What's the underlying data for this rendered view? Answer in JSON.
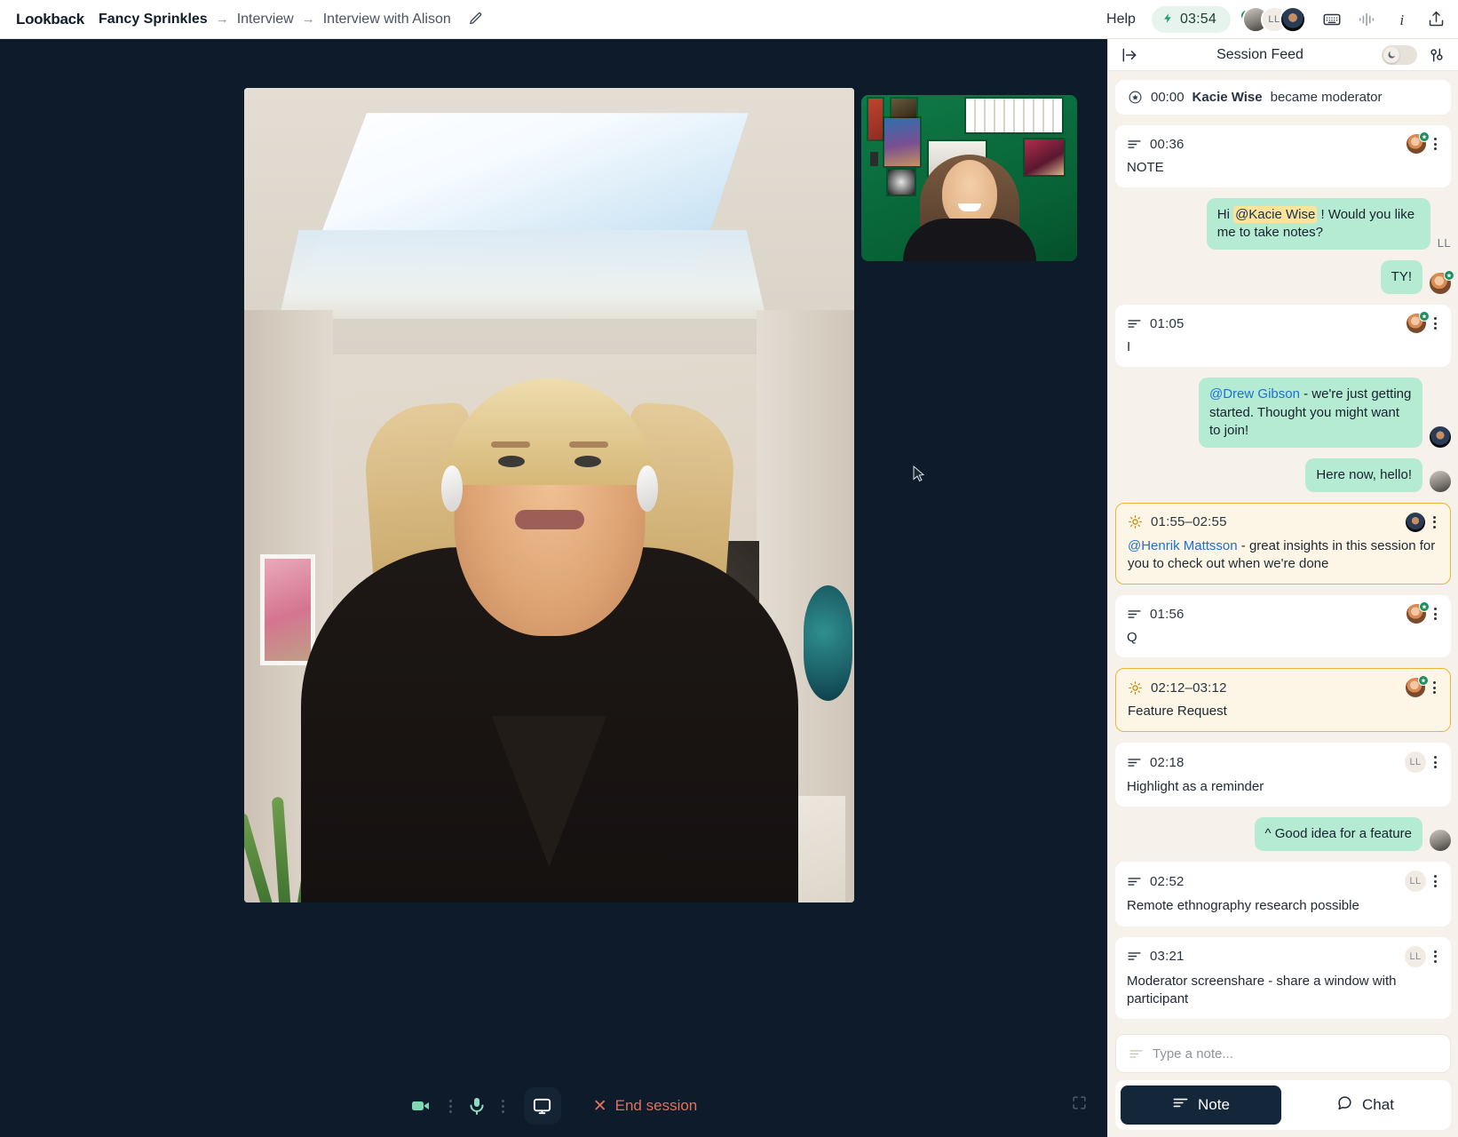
{
  "topbar": {
    "brand": "Lookback",
    "breadcrumb": [
      "Fancy Sprinkles",
      "Interview",
      "Interview with Alison"
    ],
    "separator": "→",
    "edit_icon": "pencil-icon",
    "help_label": "Help",
    "timer": "03:54",
    "timer_icon": "bolt-icon",
    "avatar_initials": "LL",
    "icons": [
      "keyboard-icon",
      "audio-waveform-icon",
      "info-icon",
      "share-icon"
    ]
  },
  "stage": {
    "controls": {
      "camera_icon": "video-camera-icon",
      "mic_icon": "microphone-icon",
      "screenshare_icon": "screen-share-icon",
      "end_session_label": "End session",
      "end_icon": "close-x-icon",
      "fullscreen_icon": "fullscreen-icon"
    }
  },
  "panel": {
    "collapse_icon": "panel-collapse-icon",
    "title": "Session Feed",
    "theme_toggle_icon": "moon-icon",
    "filter_icon": "filter-settings-icon",
    "system_event": {
      "icon": "moderator-badge-icon",
      "time": "00:00",
      "actor": "Kacie Wise",
      "text": "became moderator"
    },
    "feed": [
      {
        "kind": "note",
        "time": "00:36",
        "body": "NOTE",
        "avatar": "kacie",
        "star": true
      },
      {
        "kind": "chat",
        "align": "right",
        "mention": "@Kacie Wise",
        "prefix": "Hi ",
        "suffix": " ! Would you like me to take notes?",
        "avatar_initials": "LL"
      },
      {
        "kind": "chat",
        "align": "right",
        "text": "TY!",
        "avatar": "kacie",
        "star": true
      },
      {
        "kind": "note",
        "time": "01:05",
        "body": "I",
        "avatar": "kacie",
        "star": true
      },
      {
        "kind": "chat",
        "align": "right",
        "mention": "@Drew Gibson",
        "prefix": "",
        "suffix": " - we're just getting started. Thought you might want to join!",
        "avatar": "drew"
      },
      {
        "kind": "chat",
        "align": "right",
        "text": "Here now, hello!",
        "avatar": "henrik"
      },
      {
        "kind": "highlight",
        "time": "01:55–02:55",
        "mention": "@Henrik Mattsson",
        "suffix": " - great insights in this session for you to check out when we're done",
        "avatar": "drew"
      },
      {
        "kind": "note",
        "time": "01:56",
        "body": "Q",
        "avatar": "kacie",
        "star": true
      },
      {
        "kind": "highlight",
        "time": "02:12–03:12",
        "body": "Feature Request",
        "avatar": "kacie",
        "star": true
      },
      {
        "kind": "note",
        "time": "02:18",
        "body": "Highlight as a reminder",
        "avatar_initials": "LL"
      },
      {
        "kind": "chat",
        "align": "right",
        "text": "^ Good idea for a feature",
        "avatar": "henrik"
      },
      {
        "kind": "note",
        "time": "02:52",
        "body": "Remote ethnography research possible",
        "avatar_initials": "LL"
      },
      {
        "kind": "note",
        "time": "03:21",
        "body": "Moderator screenshare - share a window with participant",
        "avatar_initials": "LL"
      }
    ],
    "composer": {
      "note_icon": "note-lines-icon",
      "placeholder": "Type a note...",
      "tabs": [
        {
          "label": "Note",
          "icon": "note-lines-icon",
          "active": true
        },
        {
          "label": "Chat",
          "icon": "chat-bubble-icon",
          "active": false
        }
      ]
    }
  },
  "colors": {
    "stage_bg": "#0d1b2a",
    "panel_bg": "#f6f1ea",
    "accent_green": "#1f9d6a",
    "bubble_green": "#b6ebd3",
    "highlight_border": "#e9b63c",
    "highlight_bg": "#fdf6e6",
    "danger": "#e0705f",
    "mention_blue": "#1d6fd6",
    "mention_highlight": "#fbe39b"
  }
}
